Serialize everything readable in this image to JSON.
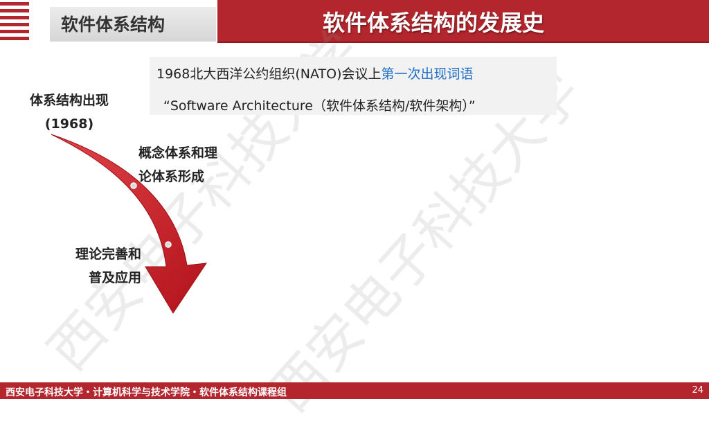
{
  "colors": {
    "brand_red": "#b3262d",
    "highlight_blue": "#1f6fc6"
  },
  "header": {
    "section_title": "软件体系结构",
    "slide_title": "软件体系结构的发展史",
    "menu_icon": "stripes-icon"
  },
  "watermark": {
    "text": "西安电子科技大学"
  },
  "info_box": {
    "line1_prefix": "1968北大西洋公约组织(NATO)会议上",
    "line1_highlight": "第一次出现词语",
    "line2": "“Software Architecture（软件体系结构/软件架构）”"
  },
  "stages": {
    "first": {
      "line1": "体系结构出现",
      "line2": "(1968)"
    },
    "second": {
      "line1": "概念体系和理",
      "line2": "论体系形成"
    },
    "third": {
      "line1": "理论完善和",
      "line2": "普及应用"
    }
  },
  "footer": {
    "text": "西安电子科技大学・计算机科学与技术学院・软件体系结构课程组",
    "page_number": "24"
  }
}
